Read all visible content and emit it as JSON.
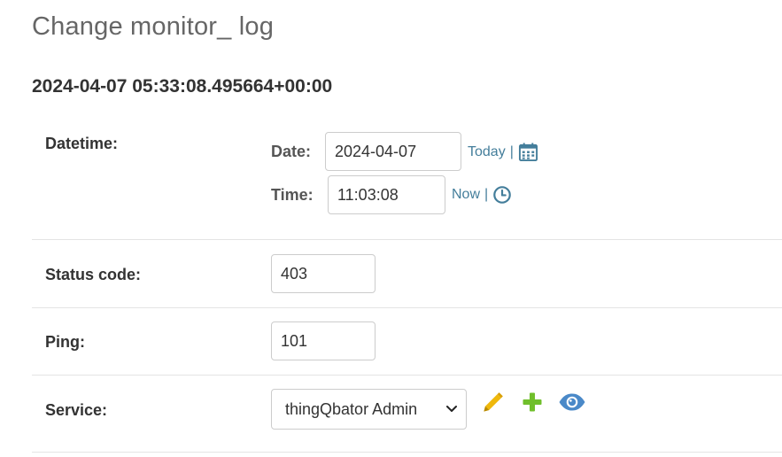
{
  "header": {
    "title": "Change monitor_ log",
    "object_title": "2024-04-07 05:33:08.495664+00:00"
  },
  "fields": {
    "datetime": {
      "label": "Datetime:",
      "date_label": "Date:",
      "date_value": "2024-04-07",
      "today_link": "Today",
      "separator": "|",
      "time_label": "Time:",
      "time_value": "11:03:08",
      "now_link": "Now"
    },
    "status_code": {
      "label": "Status code:",
      "value": "403"
    },
    "ping": {
      "label": "Ping:",
      "value": "101"
    },
    "service": {
      "label": "Service:",
      "selected": "thingQbator Admin"
    }
  },
  "icons": {
    "calendar": "calendar-icon",
    "clock": "clock-icon",
    "chevron": "chevron-down-icon",
    "change": "pencil-icon",
    "add": "plus-icon",
    "view": "eye-icon"
  },
  "colors": {
    "link": "#447e9b",
    "pencil": "#efb80b",
    "plus": "#70bf2b",
    "eye": "#4a89c8"
  }
}
